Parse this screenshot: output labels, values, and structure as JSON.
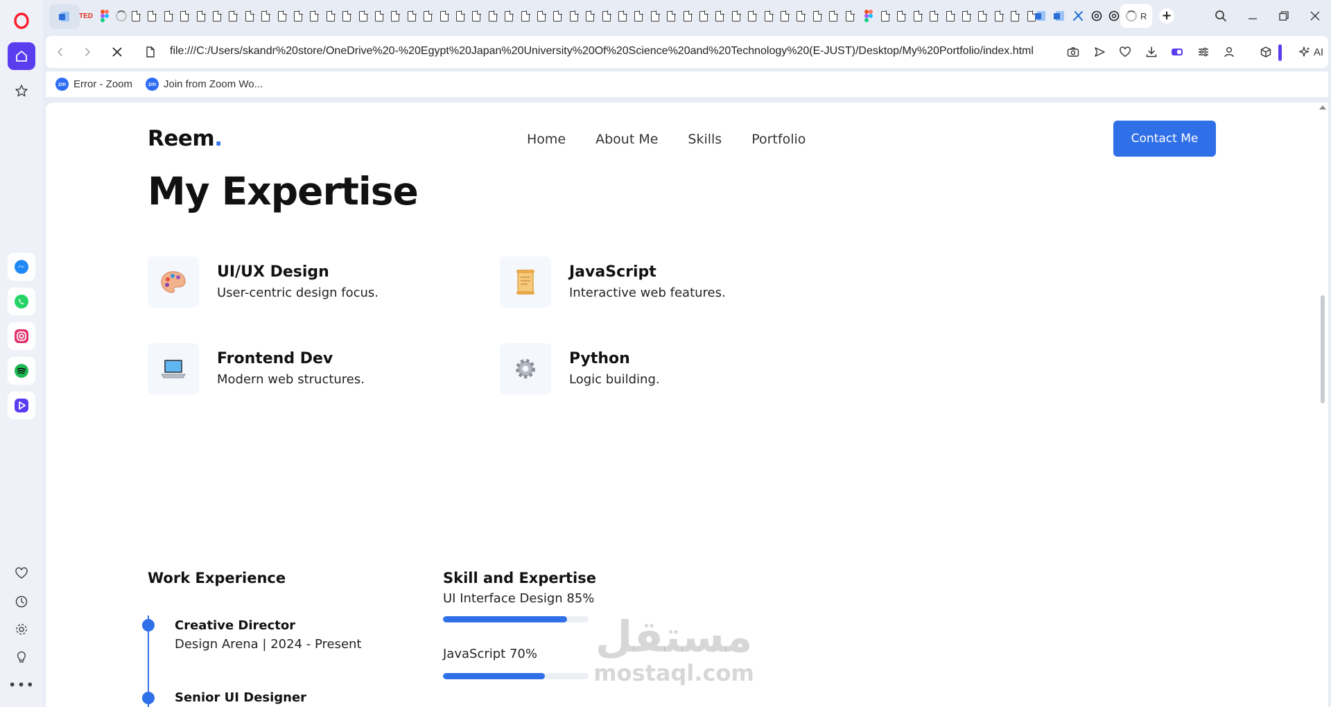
{
  "browser": {
    "active_tab_label": "R",
    "url": "file:///C:/Users/skandr%20store/OneDrive%20-%20Egypt%20Japan%20University%20Of%20Science%20and%20Technology%20(E-JUST)/Desktop/My%20Portfolio/index.html",
    "ai_label": "AI",
    "ted_label": "TED",
    "bookmarks": [
      {
        "label": "Error - Zoom",
        "icon": "zm"
      },
      {
        "label": "Join from Zoom Wo...",
        "icon": "zm"
      }
    ]
  },
  "site": {
    "logo": "Reem",
    "logo_dot": ".",
    "nav": [
      "Home",
      "About Me",
      "Skills",
      "Portfolio"
    ],
    "contact_button": "Contact Me",
    "expertise_title": "My Expertise",
    "expertise": [
      {
        "name": "UI/UX Design",
        "desc": "User-centric design focus.",
        "icon": "palette-icon"
      },
      {
        "name": "JavaScript",
        "desc": "Interactive web features.",
        "icon": "scroll-icon"
      },
      {
        "name": "Frontend Dev",
        "desc": "Modern web structures.",
        "icon": "laptop-icon"
      },
      {
        "name": "Python",
        "desc": "Logic building.",
        "icon": "gear-icon"
      }
    ],
    "work_title": "Work Experience",
    "jobs": [
      {
        "title": "Creative Director",
        "meta": "Design Arena | 2024 - Present"
      },
      {
        "title": "Senior UI Designer",
        "meta": ""
      }
    ],
    "skills_title": "Skill and Expertise",
    "skills": [
      {
        "label": "UI Interface Design 85%",
        "percent": 85
      },
      {
        "label": "JavaScript 70%",
        "percent": 70
      }
    ],
    "watermark_ar": "مستقل",
    "watermark_en": "mostaql.com"
  },
  "colors": {
    "accent": "#2f6fe8",
    "opera_red": "#ff1b2d",
    "sidebar_active": "#5b3df0"
  }
}
